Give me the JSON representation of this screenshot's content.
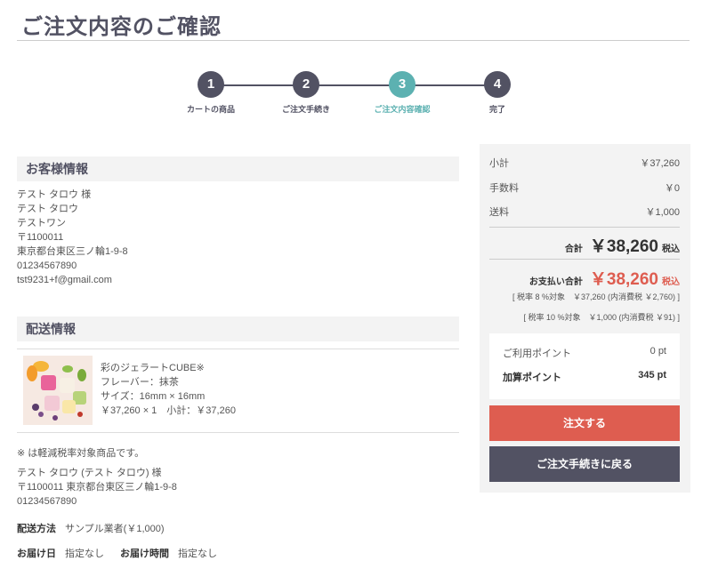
{
  "page": {
    "title": "ご注文内容のご確認"
  },
  "steps": [
    {
      "num": "1",
      "label": "カートの商品"
    },
    {
      "num": "2",
      "label": "ご注文手続き"
    },
    {
      "num": "3",
      "label": "ご注文内容確認"
    },
    {
      "num": "4",
      "label": "完了"
    }
  ],
  "colors": {
    "primary": "#525263",
    "active": "#5cb1b1",
    "accent": "#de5d50"
  },
  "customer": {
    "heading": "お客様情報",
    "lines": [
      "テスト タロウ 様",
      "テスト タロウ",
      "テストワン",
      "〒1100011",
      "東京都台東区三ノ輪1-9-8",
      "01234567890",
      "tst9231+f@gmail.com"
    ]
  },
  "shipping": {
    "heading": "配送情報",
    "item": {
      "image_icon": "gelato-product-image",
      "name": "彩のジェラートCUBE※",
      "flavor": "フレーバー：抹茶",
      "size": "サイズ：16mm × 16mm",
      "price_line": "￥37,260 × 1　小計：￥37,260"
    },
    "note": "※ は軽減税率対象商品です。",
    "address_lines": [
      "テスト タロウ (テスト タロウ) 様",
      "〒1100011 東京都台東区三ノ輪1-9-8",
      "01234567890"
    ],
    "method_label": "配送方法",
    "method_value": "サンプル業者(￥1,000)",
    "date_label": "お届け日",
    "date_value": "指定なし",
    "time_label": "お届け時間",
    "time_value": "指定なし"
  },
  "summary": {
    "subtotal_label": "小計",
    "subtotal_value": "￥37,260",
    "fee_label": "手数料",
    "fee_value": "￥0",
    "shipping_label": "送料",
    "shipping_value": "￥1,000",
    "total_label": "合計",
    "total_value": "￥38,260",
    "total_tax": "税込",
    "pay_label": "お支払い合計",
    "pay_value": "￥38,260",
    "pay_tax": "税込",
    "tax_note_8": "[ 税率 8 %対象　￥37,260 (内消費税 ￥2,760) ]",
    "tax_note_10": "[ 税率 10 %対象　￥1,000 (内消費税 ￥91) ]",
    "points_used_label": "ご利用ポイント",
    "points_used_value": "0 pt",
    "points_add_label": "加算ポイント",
    "points_add_value": "345 pt",
    "order_button": "注文する",
    "back_button": "ご注文手続きに戻る"
  }
}
